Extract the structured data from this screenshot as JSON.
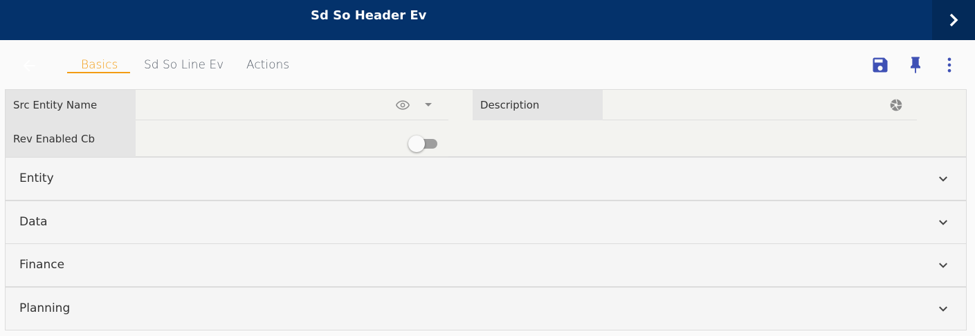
{
  "header": {
    "title": "Sd So Header Ev",
    "next_icon": "chevron-right-icon"
  },
  "toolbar": {
    "back_icon": "arrow-left-icon",
    "tabs": [
      {
        "label": "Basics",
        "active": true
      },
      {
        "label": "Sd So Line Ev",
        "active": false
      },
      {
        "label": "Actions",
        "active": false
      }
    ],
    "actions": [
      "save-icon",
      "pin-icon",
      "more-vertical-icon"
    ]
  },
  "form": {
    "src_entity_name": {
      "label": "Src Entity Name",
      "value": ""
    },
    "description": {
      "label": "Description",
      "value": ""
    },
    "rev_enabled_cb": {
      "label": "Rev Enabled Cb",
      "checked": false
    }
  },
  "sections": [
    {
      "label": "Entity"
    },
    {
      "label": "Data"
    },
    {
      "label": "Finance"
    },
    {
      "label": "Planning"
    }
  ],
  "colors": {
    "header_bg": "#04326b",
    "accent": "#f39c12",
    "icon_blue": "#3f51b5"
  }
}
